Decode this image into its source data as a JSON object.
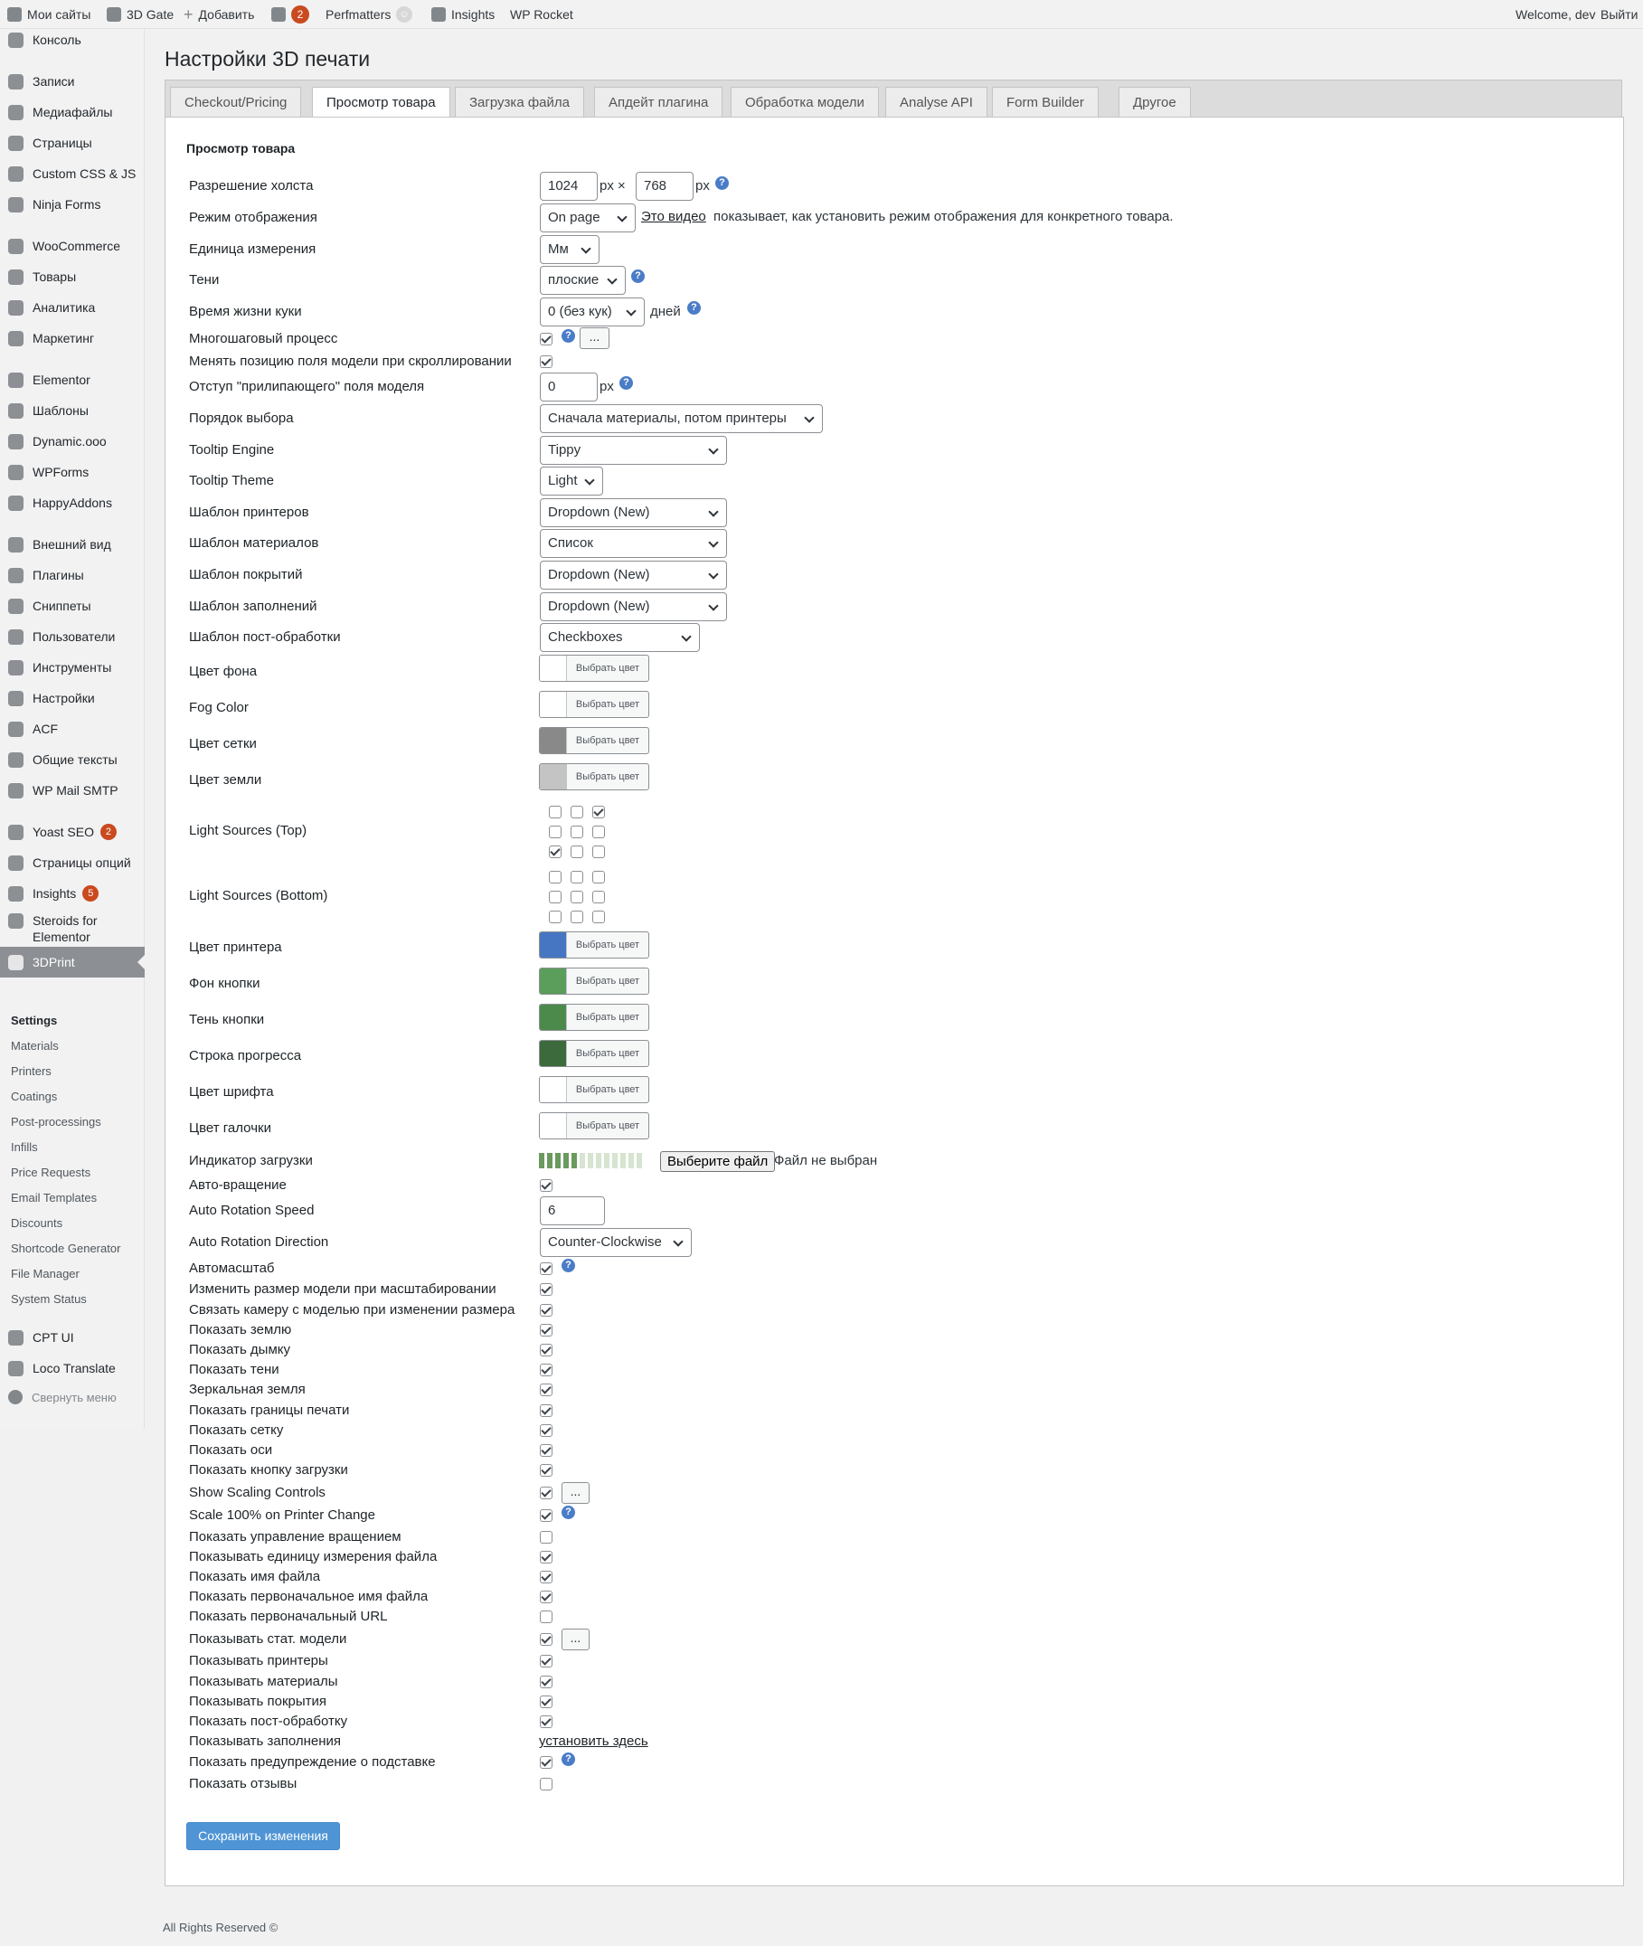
{
  "adminbar": {
    "my_sites": "Мои сайты",
    "site_name": "3D Gate",
    "add_new": "Добавить",
    "yoast_badge": "2",
    "perfmatters": "Perfmatters",
    "insights": "Insights",
    "wp_rocket": "WP Rocket",
    "welcome": "Welcome, dev",
    "logout": "Выйти"
  },
  "sidebar": {
    "items": [
      {
        "label": "Консоль",
        "icon": "dashboard-icon"
      },
      {
        "label": "Записи",
        "icon": "pin-icon"
      },
      {
        "label": "Медиафайлы",
        "icon": "media-icon"
      },
      {
        "label": "Страницы",
        "icon": "pages-icon"
      },
      {
        "label": "Custom CSS & JS",
        "icon": "plus-circle-icon"
      },
      {
        "label": "Ninja Forms",
        "icon": "forms-icon"
      },
      {
        "label": "WooCommerce",
        "icon": "woo-icon"
      },
      {
        "label": "Товары",
        "icon": "archive-icon"
      },
      {
        "label": "Аналитика",
        "icon": "bar-chart-icon"
      },
      {
        "label": "Маркетинг",
        "icon": "megaphone-icon"
      },
      {
        "label": "Elementor",
        "icon": "elementor-icon"
      },
      {
        "label": "Шаблоны",
        "icon": "folder-icon"
      },
      {
        "label": "Dynamic.ooo",
        "icon": "dynamic-icon"
      },
      {
        "label": "WPForms",
        "icon": "wpforms-icon"
      },
      {
        "label": "HappyAddons",
        "icon": "happy-icon"
      },
      {
        "label": "Внешний вид",
        "icon": "brush-icon"
      },
      {
        "label": "Плагины",
        "icon": "plugin-icon"
      },
      {
        "label": "Сниппеты",
        "icon": "scissors-icon"
      },
      {
        "label": "Пользователи",
        "icon": "users-icon"
      },
      {
        "label": "Инструменты",
        "icon": "wrench-icon"
      },
      {
        "label": "Настройки",
        "icon": "settings-icon"
      },
      {
        "label": "ACF",
        "icon": "acf-icon"
      },
      {
        "label": "Общие тексты",
        "icon": "quote-icon"
      },
      {
        "label": "WP Mail SMTP",
        "icon": "mail-icon"
      },
      {
        "label": "Yoast SEO",
        "icon": "yoast-icon",
        "badge": "2"
      },
      {
        "label": "Страницы опций",
        "icon": "gear-icon"
      },
      {
        "label": "Insights",
        "icon": "insights-icon",
        "badge": "5"
      },
      {
        "label": "Steroids for Elementor",
        "icon": "steroids-icon"
      },
      {
        "label": "3DPrint",
        "icon": "gear-icon"
      }
    ],
    "submenu": [
      "Settings",
      "Materials",
      "Printers",
      "Coatings",
      "Post-processings",
      "Infills",
      "Price Requests",
      "Email Templates",
      "Discounts",
      "Shortcode Generator",
      "File Manager",
      "System Status"
    ],
    "bottom_items": [
      {
        "label": "CPT UI",
        "icon": "cpt-icon"
      },
      {
        "label": "Loco Translate",
        "icon": "translate-icon"
      }
    ],
    "collapse": "Свернуть меню"
  },
  "page": {
    "title": "Настройки 3D печати",
    "tabs": [
      "Checkout/Pricing",
      "Просмотр товара",
      "Загрузка файла",
      "Апдейт плагина",
      "Обработка модели",
      "Analyse API",
      "Form Builder",
      "Другое"
    ],
    "active_tab": 1,
    "section_heading": "Просмотр товара"
  },
  "fields": {
    "canvas_resolution": {
      "label": "Разрешение холста",
      "width": "1024",
      "height": "768",
      "unit": "px",
      "separator": "px ×"
    },
    "display_mode": {
      "label": "Режим отображения",
      "value": "On page",
      "link": "Это видео",
      "note": "показывает, как установить режим отображения для конкретного товара."
    },
    "units": {
      "label": "Единица измерения",
      "value": "Мм"
    },
    "shadows": {
      "label": "Тени",
      "value": "плоские"
    },
    "cookie_lifetime": {
      "label": "Время жизни куки",
      "value": "0 (без кук)",
      "suffix": "дней"
    },
    "multistep": {
      "label": "Многошаговый процесс",
      "checked": true,
      "button": "..."
    },
    "sticky_position": {
      "label": "Менять позицию поля модели при скроллировании",
      "checked": true
    },
    "sticky_offset": {
      "label": "Отступ \"прилипающего\" поля моделя",
      "value": "0",
      "unit": "px"
    },
    "selection_order": {
      "label": "Порядок выбора",
      "value": "Сначала материалы, потом принтеры"
    },
    "tooltip_engine": {
      "label": "Tooltip Engine",
      "value": "Tippy"
    },
    "tooltip_theme": {
      "label": "Tooltip Theme",
      "value": "Light"
    },
    "printer_template": {
      "label": "Шаблон принтеров",
      "value": "Dropdown (New)"
    },
    "material_template": {
      "label": "Шаблон материалов",
      "value": "Список"
    },
    "coating_template": {
      "label": "Шаблон покрытий",
      "value": "Dropdown (New)"
    },
    "infill_template": {
      "label": "Шаблон заполнений",
      "value": "Dropdown (New)"
    },
    "postprocess_template": {
      "label": "Шаблон пост-обработки",
      "value": "Checkboxes"
    },
    "background_color": {
      "label": "Цвет фона",
      "color": "#ffffff",
      "button": "Выбрать цвет"
    },
    "fog_color": {
      "label": "Fog Color",
      "color": "#ffffff",
      "button": "Выбрать цвет"
    },
    "grid_color": {
      "label": "Цвет сетки",
      "color": "#898989",
      "button": "Выбрать цвет"
    },
    "ground_color": {
      "label": "Цвет земли",
      "color": "#c4c4c4",
      "button": "Выбрать цвет"
    },
    "light_top": {
      "label": "Light Sources (Top)",
      "grid": [
        false,
        false,
        true,
        false,
        false,
        false,
        true,
        false,
        false
      ]
    },
    "light_bottom": {
      "label": "Light Sources (Bottom)",
      "grid": [
        false,
        false,
        false,
        false,
        false,
        false,
        false,
        false,
        false
      ]
    },
    "printer_color": {
      "label": "Цвет принтера",
      "color": "#4676c1",
      "button": "Выбрать цвет"
    },
    "button_background": {
      "label": "Фон кнопки",
      "color": "#5b9d5b",
      "button": "Выбрать цвет"
    },
    "button_shadow": {
      "label": "Тень кнопки",
      "color": "#4c8a4c",
      "button": "Выбрать цвет"
    },
    "progress_bar": {
      "label": "Строка прогресса",
      "color": "#3c6a3c",
      "button": "Выбрать цвет"
    },
    "font_color": {
      "label": "Цвет шрифта",
      "color": "#ffffff",
      "button": "Выбрать цвет"
    },
    "checkmark_color": {
      "label": "Цвет галочки",
      "color": "#ffffff",
      "button": "Выбрать цвет"
    },
    "loading_indicator": {
      "label": "Индикатор загрузки",
      "file_button": "Выберите файл",
      "file_status": "Файл не выбран",
      "filled_segments": 5,
      "total_segments": 13
    },
    "auto_rotation": {
      "label": "Авто-вращение",
      "checked": true
    },
    "auto_rotation_speed": {
      "label": "Auto Rotation Speed",
      "value": "6"
    },
    "auto_rotation_direction": {
      "label": "Auto Rotation Direction",
      "value": "Counter-Clockwise"
    },
    "autoscale": {
      "label": "Автомасштаб",
      "checked": true
    },
    "resize_on_scale": {
      "label": "Изменить размер модели при масштабировании",
      "checked": true
    },
    "bind_camera": {
      "label": "Связать камеру с моделью при изменении размера",
      "checked": true
    },
    "show_ground": {
      "label": "Показать землю",
      "checked": true
    },
    "show_fog": {
      "label": "Показать дымку",
      "checked": true
    },
    "show_shadows": {
      "label": "Показать тени",
      "checked": true
    },
    "mirror_ground": {
      "label": "Зеркальная земля",
      "checked": true
    },
    "show_print_bounds": {
      "label": "Показать границы печати",
      "checked": true
    },
    "show_grid": {
      "label": "Показать сетку",
      "checked": true
    },
    "show_axes": {
      "label": "Показать оси",
      "checked": true
    },
    "show_upload_button": {
      "label": "Показать кнопку загрузки",
      "checked": true
    },
    "show_scaling_controls": {
      "label": "Show Scaling Controls",
      "checked": true,
      "button": "..."
    },
    "scale_100": {
      "label": "Scale 100% on Printer Change",
      "checked": true
    },
    "show_rotation_controls": {
      "label": "Показать управление вращением",
      "checked": false
    },
    "show_file_unit": {
      "label": "Показывать единицу измерения файла",
      "checked": true
    },
    "show_filename": {
      "label": "Показать имя файла",
      "checked": true
    },
    "show_original_filename": {
      "label": "Показать первоначальное имя файла",
      "checked": true
    },
    "show_original_url": {
      "label": "Показать первоначальный URL",
      "checked": false
    },
    "show_model_stats": {
      "label": "Показывать стат. модели",
      "checked": true,
      "button": "..."
    },
    "show_printers": {
      "label": "Показывать принтеры",
      "checked": true
    },
    "show_materials": {
      "label": "Показывать материалы",
      "checked": true
    },
    "show_coatings": {
      "label": "Показывать покрытия",
      "checked": true
    },
    "show_postprocessing": {
      "label": "Показать пост-обработку",
      "checked": true
    },
    "show_infills": {
      "label": "Показывать заполнения",
      "link": "установить здесь"
    },
    "show_support_warning": {
      "label": "Показать предупреждение о подставке",
      "checked": true
    },
    "show_reviews": {
      "label": "Показать отзывы",
      "checked": false
    }
  },
  "actions": {
    "save": "Сохранить изменения"
  },
  "footer": {
    "text": "All Rights Reserved ©"
  }
}
